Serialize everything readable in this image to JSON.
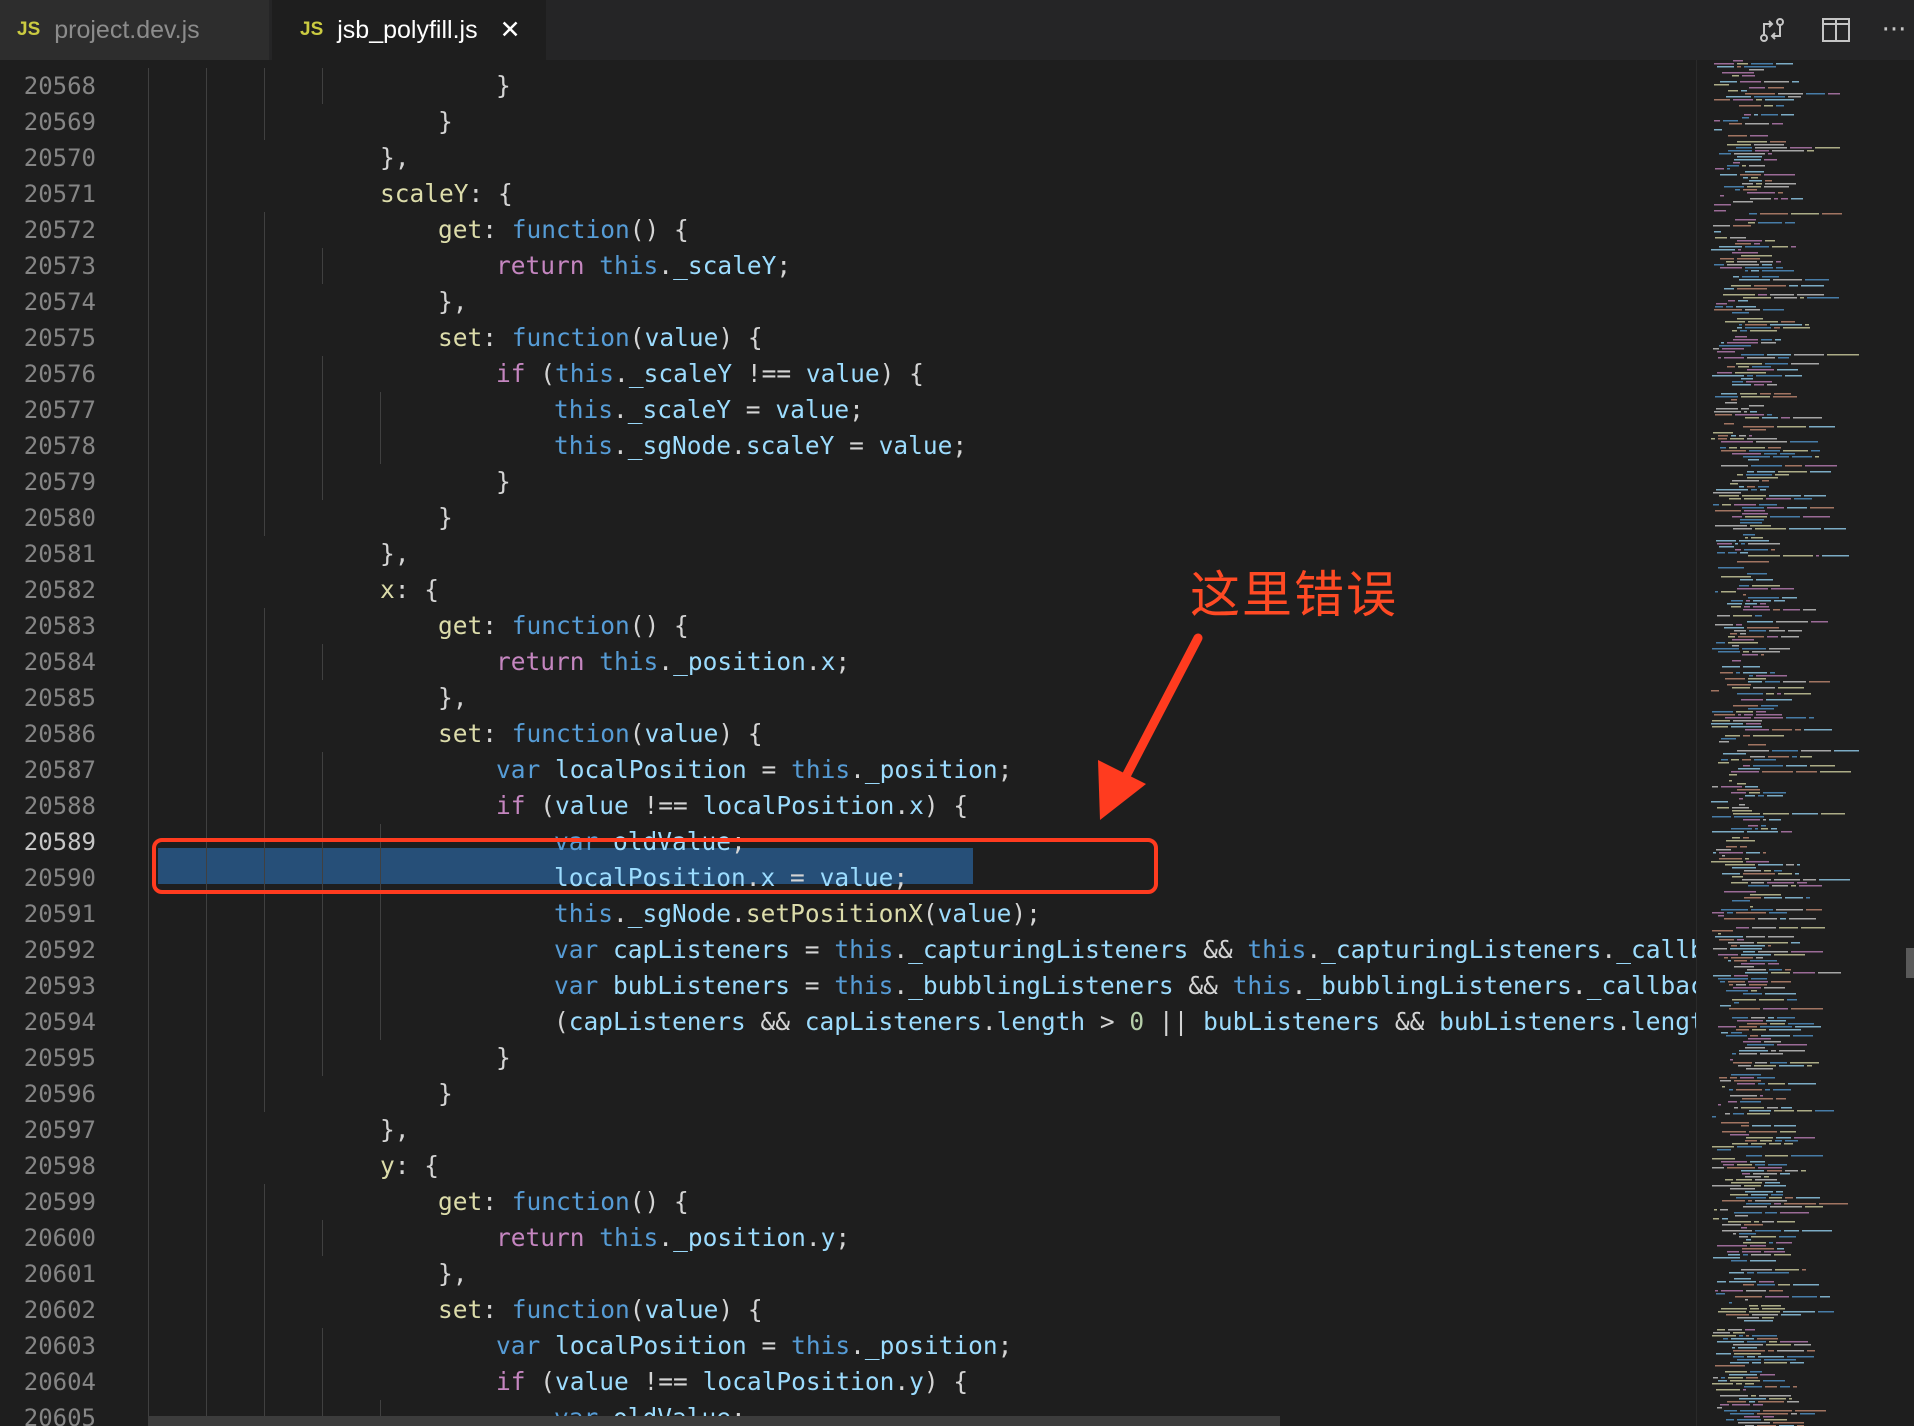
{
  "tabs": [
    {
      "badge": "JS",
      "label": "project.dev.js",
      "active": false
    },
    {
      "badge": "JS",
      "label": "jsb_polyfill.js",
      "active": true,
      "close": "✕"
    }
  ],
  "toolbar_icons": [
    "compare-changes-icon",
    "split-editor-icon",
    "more-actions-icon"
  ],
  "toolbar": {
    "more": "···"
  },
  "editor": {
    "active_line": "20589",
    "lines": [
      {
        "n": "20568",
        "indent": 4,
        "code": "}"
      },
      {
        "n": "20569",
        "indent": 3,
        "code": "}"
      },
      {
        "n": "20570",
        "indent": 2,
        "code": "},"
      },
      {
        "n": "20571",
        "indent": 2,
        "code": "scaleY: {"
      },
      {
        "n": "20572",
        "indent": 3,
        "code": "get: function() {"
      },
      {
        "n": "20573",
        "indent": 4,
        "code": "return this._scaleY;"
      },
      {
        "n": "20574",
        "indent": 3,
        "code": "},"
      },
      {
        "n": "20575",
        "indent": 3,
        "code": "set: function(value) {"
      },
      {
        "n": "20576",
        "indent": 4,
        "code": "if (this._scaleY !== value) {"
      },
      {
        "n": "20577",
        "indent": 5,
        "code": "this._scaleY = value;"
      },
      {
        "n": "20578",
        "indent": 5,
        "code": "this._sgNode.scaleY = value;"
      },
      {
        "n": "20579",
        "indent": 4,
        "code": "}"
      },
      {
        "n": "20580",
        "indent": 3,
        "code": "}"
      },
      {
        "n": "20581",
        "indent": 2,
        "code": "},"
      },
      {
        "n": "20582",
        "indent": 2,
        "code": "x: {"
      },
      {
        "n": "20583",
        "indent": 3,
        "code": "get: function() {"
      },
      {
        "n": "20584",
        "indent": 4,
        "code": "return this._position.x;"
      },
      {
        "n": "20585",
        "indent": 3,
        "code": "},"
      },
      {
        "n": "20586",
        "indent": 3,
        "code": "set: function(value) {"
      },
      {
        "n": "20587",
        "indent": 4,
        "code": "var localPosition = this._position;"
      },
      {
        "n": "20588",
        "indent": 4,
        "code": "if (value !== localPosition.x) {"
      },
      {
        "n": "20589",
        "indent": 5,
        "code": "var oldValue;"
      },
      {
        "n": "20590",
        "indent": 5,
        "code": "localPosition.x = value;"
      },
      {
        "n": "20591",
        "indent": 5,
        "code": "this._sgNode.setPositionX(value);"
      },
      {
        "n": "20592",
        "indent": 5,
        "code": "var capListeners = this._capturingListeners && this._capturingListeners._callba"
      },
      {
        "n": "20593",
        "indent": 5,
        "code": "var bubListeners = this._bubblingListeners && this._bubblingListeners._callback"
      },
      {
        "n": "20594",
        "indent": 5,
        "code": "(capListeners && capListeners.length > 0 || bubListeners && bubListeners.length"
      },
      {
        "n": "20595",
        "indent": 4,
        "code": "}"
      },
      {
        "n": "20596",
        "indent": 3,
        "code": "}"
      },
      {
        "n": "20597",
        "indent": 2,
        "code": "},"
      },
      {
        "n": "20598",
        "indent": 2,
        "code": "y: {"
      },
      {
        "n": "20599",
        "indent": 3,
        "code": "get: function() {"
      },
      {
        "n": "20600",
        "indent": 4,
        "code": "return this._position.y;"
      },
      {
        "n": "20601",
        "indent": 3,
        "code": "},"
      },
      {
        "n": "20602",
        "indent": 3,
        "code": "set: function(value) {"
      },
      {
        "n": "20603",
        "indent": 4,
        "code": "var localPosition = this._position;"
      },
      {
        "n": "20604",
        "indent": 4,
        "code": "if (value !== localPosition.y) {"
      },
      {
        "n": "20605",
        "indent": 5,
        "code": "var oldValue;"
      }
    ]
  },
  "annotation": {
    "text": "这里错误",
    "color": "#ff3b1f",
    "target_line": "20588"
  },
  "colors": {
    "background": "#1e1e1e",
    "tabbar": "#252526",
    "selection": "#264f78",
    "keyword": "#c586c0",
    "storage": "#569cd6",
    "property": "#9cdcfe",
    "function_call": "#dcdcaa",
    "number": "#b5cea8"
  }
}
